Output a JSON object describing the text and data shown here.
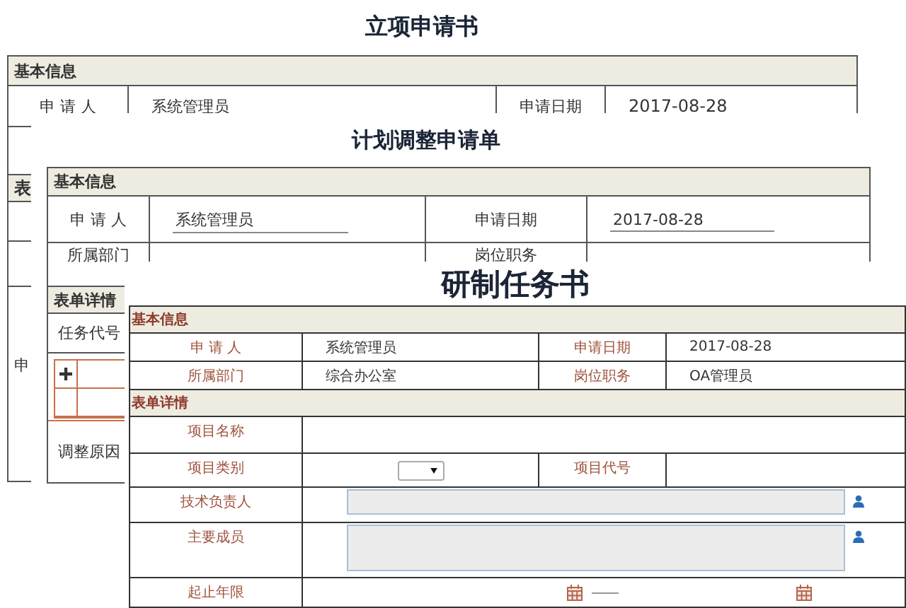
{
  "back_form": {
    "title": "立项申请书",
    "basic_header": "基本信息",
    "applicant_label": "申 请 人",
    "applicant": "系统管理员",
    "date_label": "申请日期",
    "date": "2017-08-28",
    "details_header_fragment": "表",
    "row_label_fragment": "申"
  },
  "middle_form": {
    "title": "计划调整申请单",
    "basic_header": "基本信息",
    "rows": [
      {
        "label": "申 请 人",
        "value": "系统管理员",
        "label2": "申请日期",
        "value2": "2017-08-28"
      },
      {
        "label": "所属部门",
        "label2": "岗位职务"
      }
    ],
    "details_header": "表单详情",
    "task_label": "任务代号",
    "reason_label": "调整原因"
  },
  "front_form": {
    "title": "研制任务书",
    "basic_header": "基本信息",
    "rows": [
      {
        "label": "申 请 人",
        "value": "系统管理员",
        "label2": "申请日期",
        "value2": "2017-08-28"
      },
      {
        "label": "所属部门",
        "value": "综合办公室",
        "label2": "岗位职务",
        "value2": "OA管理员"
      }
    ],
    "details_header": "表单详情",
    "details": [
      {
        "kind": "text",
        "label": "项目名称"
      },
      {
        "kind": "select",
        "label": "项目类别",
        "label2": "项目代号"
      },
      {
        "kind": "picker",
        "label": "技术负责人"
      },
      {
        "kind": "picker_area",
        "label": "主要成员"
      },
      {
        "kind": "date_range",
        "label": "起止年限"
      }
    ]
  }
}
